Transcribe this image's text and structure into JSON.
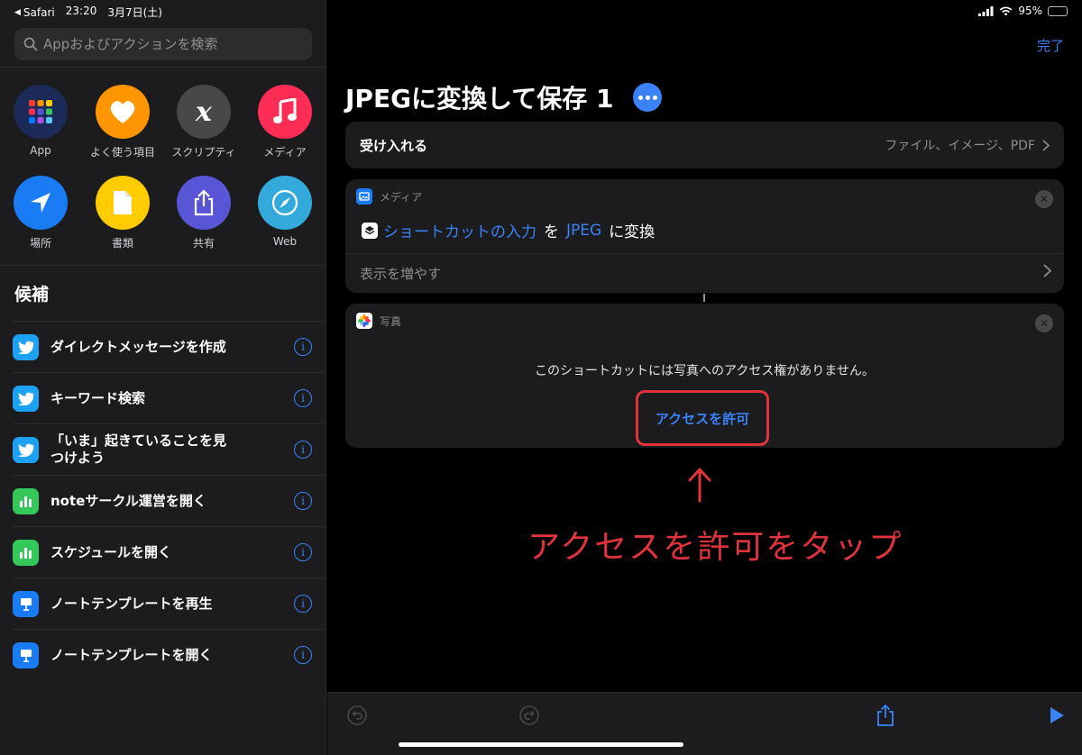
{
  "status_bar": {
    "back_app": "Safari",
    "time": "23:20",
    "date": "3月7日(土)",
    "battery": "95%",
    "battery_level": 0.95
  },
  "sidebar": {
    "search": {
      "placeholder": "Appおよびアクションを検索"
    },
    "categories": [
      {
        "label": "App",
        "icon": "app-grid-icon",
        "color": "#1c2a5a"
      },
      {
        "label": "よく使う項目",
        "icon": "heart-icon",
        "color": "#ff9500"
      },
      {
        "label": "スクリプティ",
        "icon": "script-x-icon",
        "color": "#48484a"
      },
      {
        "label": "メディア",
        "icon": "music-note-icon",
        "color": "#ff2d55"
      },
      {
        "label": "場所",
        "icon": "location-arrow-icon",
        "color": "#1a7cf5"
      },
      {
        "label": "書類",
        "icon": "document-icon",
        "color": "#ffcc00"
      },
      {
        "label": "共有",
        "icon": "share-icon",
        "color": "#5856d6"
      },
      {
        "label": "Web",
        "icon": "compass-icon",
        "color": "#34aadc"
      }
    ],
    "suggestions_title": "候補",
    "suggestions": [
      {
        "label": "ダイレクトメッセージを作成",
        "icon": "twitter-icon",
        "color": "#1da1f2"
      },
      {
        "label": "キーワード検索",
        "icon": "twitter-icon",
        "color": "#1da1f2"
      },
      {
        "label": "「いま」起きていることを見つけよう",
        "icon": "twitter-icon",
        "color": "#1da1f2"
      },
      {
        "label": "noteサークル運営を開く",
        "icon": "numbers-icon",
        "color": "#34c759"
      },
      {
        "label": "スケジュールを開く",
        "icon": "numbers-icon",
        "color": "#34c759"
      },
      {
        "label": "ノートテンプレートを再生",
        "icon": "keynote-icon",
        "color": "#1a7cf5"
      },
      {
        "label": "ノートテンプレートを開く",
        "icon": "keynote-icon",
        "color": "#1a7cf5"
      }
    ],
    "info_glyph": "i"
  },
  "main": {
    "done": "完了",
    "title": "JPEGに変換して保存 1",
    "accepts": {
      "label": "受け入れる",
      "value": "ファイル、イメージ、PDF"
    },
    "action": {
      "category": "メディア",
      "input_token": "ショートカットの入力",
      "word_wo": "を",
      "format_token": "JPEG",
      "word_convert": "に変換",
      "show_more": "表示を増やす"
    },
    "photos": {
      "category": "写真",
      "message": "このショートカットには写真へのアクセス権がありません。",
      "allow": "アクセスを許可"
    },
    "annotation": "アクセスを許可をタップ"
  },
  "colors": {
    "accent": "#3b82f6",
    "annotation": "#e0333c"
  }
}
